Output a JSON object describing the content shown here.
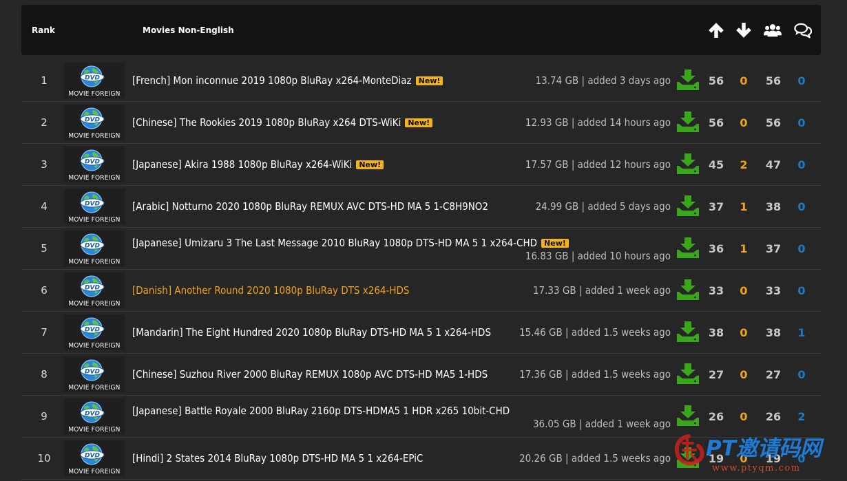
{
  "header": {
    "rank_label": "Rank",
    "category_label": "Movies Non-English",
    "icons": [
      "arrow-up-icon",
      "arrow-down-icon",
      "users-icon",
      "comments-icon"
    ]
  },
  "thumb_label": "MOVIE FOREIGN",
  "badge_label": "New!",
  "rows": [
    {
      "rank": "1",
      "title": "[French] Mon inconnue 2019 1080p BluRay x264-MonteDiaz",
      "new": true,
      "info": "13.74 GB | added 3 days ago",
      "seeders": "56",
      "leechers": "0",
      "completed": "56",
      "comments": "0"
    },
    {
      "rank": "2",
      "title": "[Chinese] The Rookies 2019 1080p BluRay x264 DTS-WiKi",
      "new": true,
      "info": "12.93 GB | added 14 hours ago",
      "seeders": "56",
      "leechers": "0",
      "completed": "56",
      "comments": "0"
    },
    {
      "rank": "3",
      "title": "[Japanese] Akira 1988 1080p BluRay x264-WiKi",
      "new": true,
      "info": "17.57 GB | added 12 hours ago",
      "seeders": "45",
      "leechers": "2",
      "completed": "47",
      "comments": "0"
    },
    {
      "rank": "4",
      "title": "[Arabic] Notturno 2020 1080p BluRay REMUX AVC DTS-HD MA 5 1-C8H9NO2",
      "new": false,
      "info": "24.99 GB | added 5 days ago",
      "seeders": "37",
      "leechers": "1",
      "completed": "38",
      "comments": "0"
    },
    {
      "rank": "5",
      "title": "[Japanese] Umizaru 3 The Last Message 2010 BluRay 1080p DTS-HD MA 5 1 x264-CHD",
      "new": true,
      "wrap": true,
      "info": "16.83 GB | added 10 hours ago",
      "seeders": "36",
      "leechers": "1",
      "completed": "37",
      "comments": "0"
    },
    {
      "rank": "6",
      "title": "[Danish] Another Round 2020 1080p BluRay DTS x264-HDS",
      "new": false,
      "highlight": true,
      "info": "17.33 GB | added 1 week ago",
      "seeders": "33",
      "leechers": "0",
      "completed": "33",
      "comments": "0"
    },
    {
      "rank": "7",
      "title": "[Mandarin] The Eight Hundred 2020 1080p BluRay DTS-HD MA 5 1 x264-HDS",
      "new": false,
      "info": "15.46 GB | added 1.5 weeks ago",
      "seeders": "38",
      "leechers": "0",
      "completed": "38",
      "comments": "1"
    },
    {
      "rank": "8",
      "title": "[Chinese] Suzhou River 2000 BluRay REMUX 1080p AVC DTS-HD MA5 1-HDS",
      "new": false,
      "info": "17.36 GB | added 1.5 weeks ago",
      "seeders": "27",
      "leechers": "0",
      "completed": "27",
      "comments": "0"
    },
    {
      "rank": "9",
      "title": "[Japanese] Battle Royale 2000 BluRay 2160p DTS-HDMA5 1 HDR x265 10bit-CHD",
      "new": false,
      "wrap": true,
      "info": "36.05 GB | added 1 week ago",
      "seeders": "26",
      "leechers": "0",
      "completed": "26",
      "comments": "2"
    },
    {
      "rank": "10",
      "title": "[Hindi] 2 States 2014 BluRay 1080p DTS-HD MA 5 1 x264-EPiC",
      "new": false,
      "info": "20.26 GB | added 1.5 weeks ago",
      "seeders": "19",
      "leechers": "0",
      "completed": "19",
      "comments": "0"
    }
  ],
  "watermark": {
    "text": "PT邀请码网",
    "url": "www.ptyqm.com"
  },
  "colors": {
    "accent": "#f0a21b",
    "download": "#3aa61c",
    "comments": "#1e7bc2",
    "badge": "#f3b11c"
  }
}
